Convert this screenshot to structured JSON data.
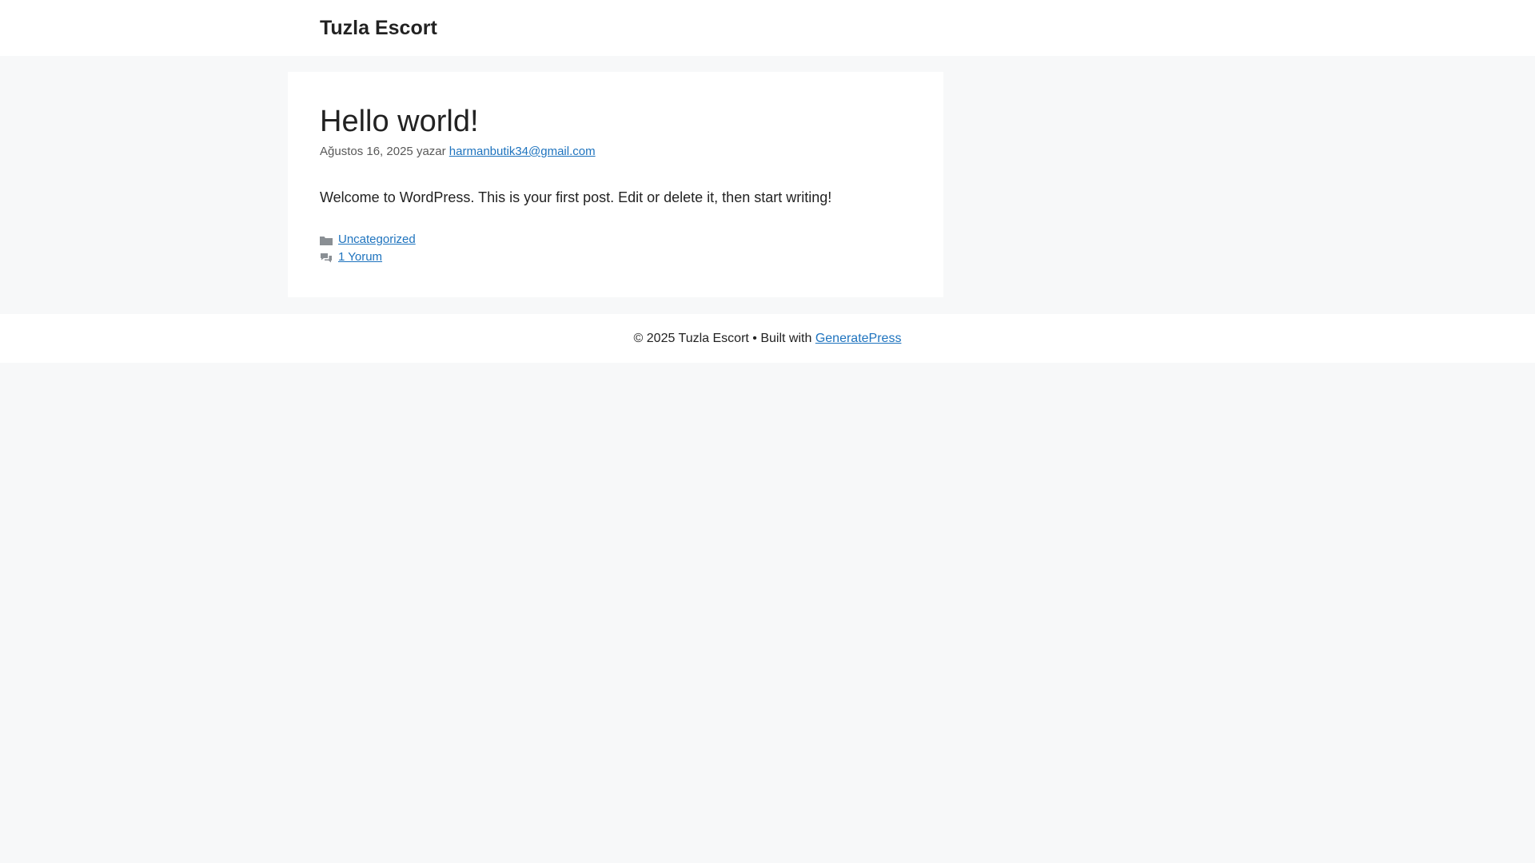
{
  "header": {
    "site_title": "Tuzla Escort"
  },
  "post": {
    "title": "Hello world!",
    "date": "Ağustos 16, 2025",
    "by_label": "yazar",
    "author": "harmanbutik34@gmail.com",
    "content": "Welcome to WordPress. This is your first post. Edit or delete it, then start writing!",
    "category_icon": "folder-icon",
    "category": "Uncategorized",
    "comments_icon": "comments-icon",
    "comments_link": "1 Yorum"
  },
  "footer": {
    "copyright": "© 2025 Tuzla Escort • Built with",
    "theme_link": "GeneratePress"
  },
  "colors": {
    "background": "#f7f8f9",
    "surface": "#ffffff",
    "text": "#222222",
    "meta_text": "#595959",
    "link": "#1e73be",
    "icon": "#8a8f94"
  }
}
